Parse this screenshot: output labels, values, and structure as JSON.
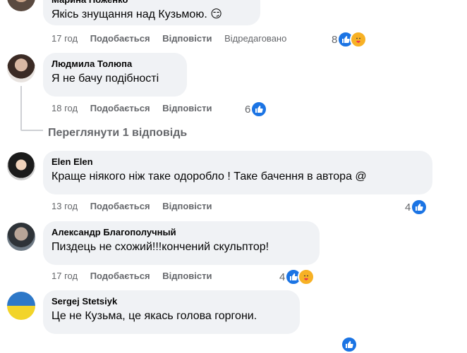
{
  "comments": [
    {
      "author": "Марина Ноженко",
      "text": "Якісь знущання над Кузьмою. 😏",
      "time": "17 год",
      "like_label": "Подобається",
      "reply_label": "Відповісти",
      "edited_label": "Відредаговано",
      "reaction_count": "8",
      "reactions": [
        "like-icon",
        "care-icon"
      ]
    },
    {
      "author": "Людмила Толюпа",
      "text": "Я не бачу подібності",
      "time": "18 год",
      "like_label": "Подобається",
      "reply_label": "Відповісти",
      "reaction_count": "6",
      "reactions": [
        "like-icon"
      ]
    },
    {
      "author": "Elen Elen",
      "text": "Краще ніякого ніж таке одоробло ! Таке бачення в автора @",
      "time": "13 год",
      "like_label": "Подобається",
      "reply_label": "Відповісти",
      "reaction_count": "4",
      "reactions": [
        "like-icon"
      ]
    },
    {
      "author": "Александр Благополучный",
      "text": "Пиздець не схожий!!!кончений скульптор!",
      "time": "17 год",
      "like_label": "Подобається",
      "reply_label": "Відповісти",
      "reaction_count": "4",
      "reactions": [
        "like-icon",
        "care-icon"
      ]
    },
    {
      "author": "Sergej Stetsiyk",
      "text": "Це не Кузьма, це якась голова горгони.",
      "reactions": [
        "like-icon"
      ]
    }
  ],
  "view_replies_label": "Переглянути 1 відповідь",
  "colors": {
    "like": "#1b74e4",
    "care": "#f7b125",
    "bubble": "#f0f2f5",
    "meta": "#65676b"
  }
}
